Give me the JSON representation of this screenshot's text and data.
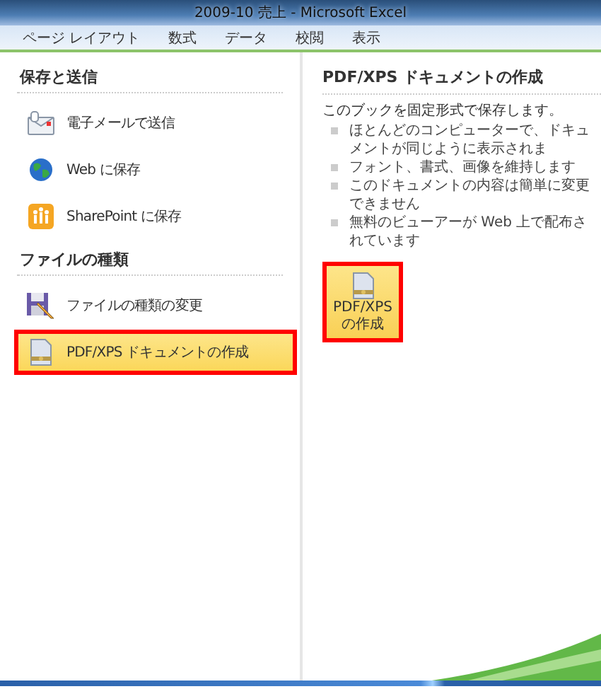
{
  "window": {
    "title": "2009-10 売上 - Microsoft Excel"
  },
  "ribbon_tabs": [
    {
      "label": "ページ レイアウト"
    },
    {
      "label": "数式"
    },
    {
      "label": "データ"
    },
    {
      "label": "校閲"
    },
    {
      "label": "表示"
    }
  ],
  "sections": [
    {
      "heading": "保存と送信",
      "items": [
        {
          "label": "電子メールで送信",
          "kind": "mail",
          "selected": false,
          "highlighted": false
        },
        {
          "label": "Web に保存",
          "kind": "globe",
          "selected": false,
          "highlighted": false
        },
        {
          "label": "SharePoint に保存",
          "kind": "sharepoint",
          "selected": false,
          "highlighted": false
        }
      ]
    },
    {
      "heading": "ファイルの種類",
      "items": [
        {
          "label": "ファイルの種類の変更",
          "kind": "filetype",
          "selected": false,
          "highlighted": false
        },
        {
          "label": "PDF/XPS ドキュメントの作成",
          "kind": "document",
          "selected": true,
          "highlighted": true
        }
      ]
    }
  ],
  "detail": {
    "heading": "PDF/XPS ドキュメントの作成",
    "description": "このブックを固定形式で保存します。",
    "bullets": [
      "ほとんどのコンピューターで、ドキュメントが同じように表示されま",
      "フォント、書式、画像を維持します",
      "このドキュメントの内容は簡単に変更できません",
      "無料のビューアーが Web 上で配布されています"
    ],
    "action": {
      "lines": [
        "PDF/XPS",
        "の作成"
      ],
      "highlighted": true
    }
  }
}
